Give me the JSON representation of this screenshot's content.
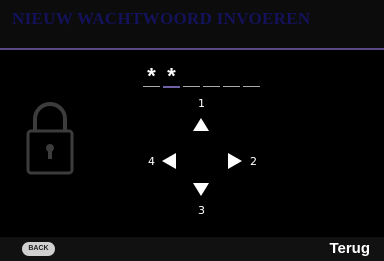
{
  "dialog": {
    "title": "NIEUW WACHTWOORD INVOEREN"
  },
  "password": {
    "slots": [
      "*",
      "*",
      "",
      "",
      "",
      ""
    ],
    "active_index": 1
  },
  "keypad": {
    "up": "1",
    "right": "2",
    "down": "3",
    "left": "4"
  },
  "footer": {
    "back_button": "BACK",
    "back_label": "Terug"
  },
  "colors": {
    "title": "#13125a",
    "divider": "#5a4a86",
    "lock_icon": "#3c3c3c"
  }
}
